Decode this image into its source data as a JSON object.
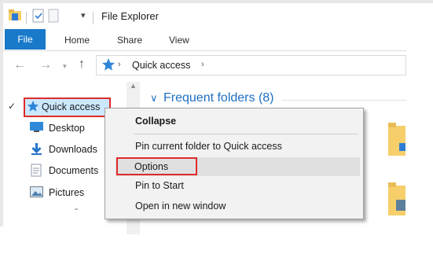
{
  "window": {
    "title": "File Explorer"
  },
  "ribbon": {
    "tabs": [
      "File",
      "Home",
      "Share",
      "View"
    ]
  },
  "address": {
    "breadcrumb": "Quick access"
  },
  "nav_pane": {
    "items": [
      {
        "label": "Quick access",
        "icon": "star-icon"
      },
      {
        "label": "Desktop",
        "icon": "desktop-icon"
      },
      {
        "label": "Downloads",
        "icon": "download-icon"
      },
      {
        "label": "Documents",
        "icon": "documents-icon"
      },
      {
        "label": "Pictures",
        "icon": "pictures-icon"
      }
    ]
  },
  "main": {
    "group_header": "Frequent folders (8)"
  },
  "context_menu": {
    "items": [
      "Collapse",
      "Pin current folder to Quick access",
      "Options",
      "Pin to Start",
      "Open in new window"
    ]
  },
  "colors": {
    "accent": "#1979ca",
    "highlight_box": "#e02a2a",
    "folder": "#f6cf6b"
  }
}
